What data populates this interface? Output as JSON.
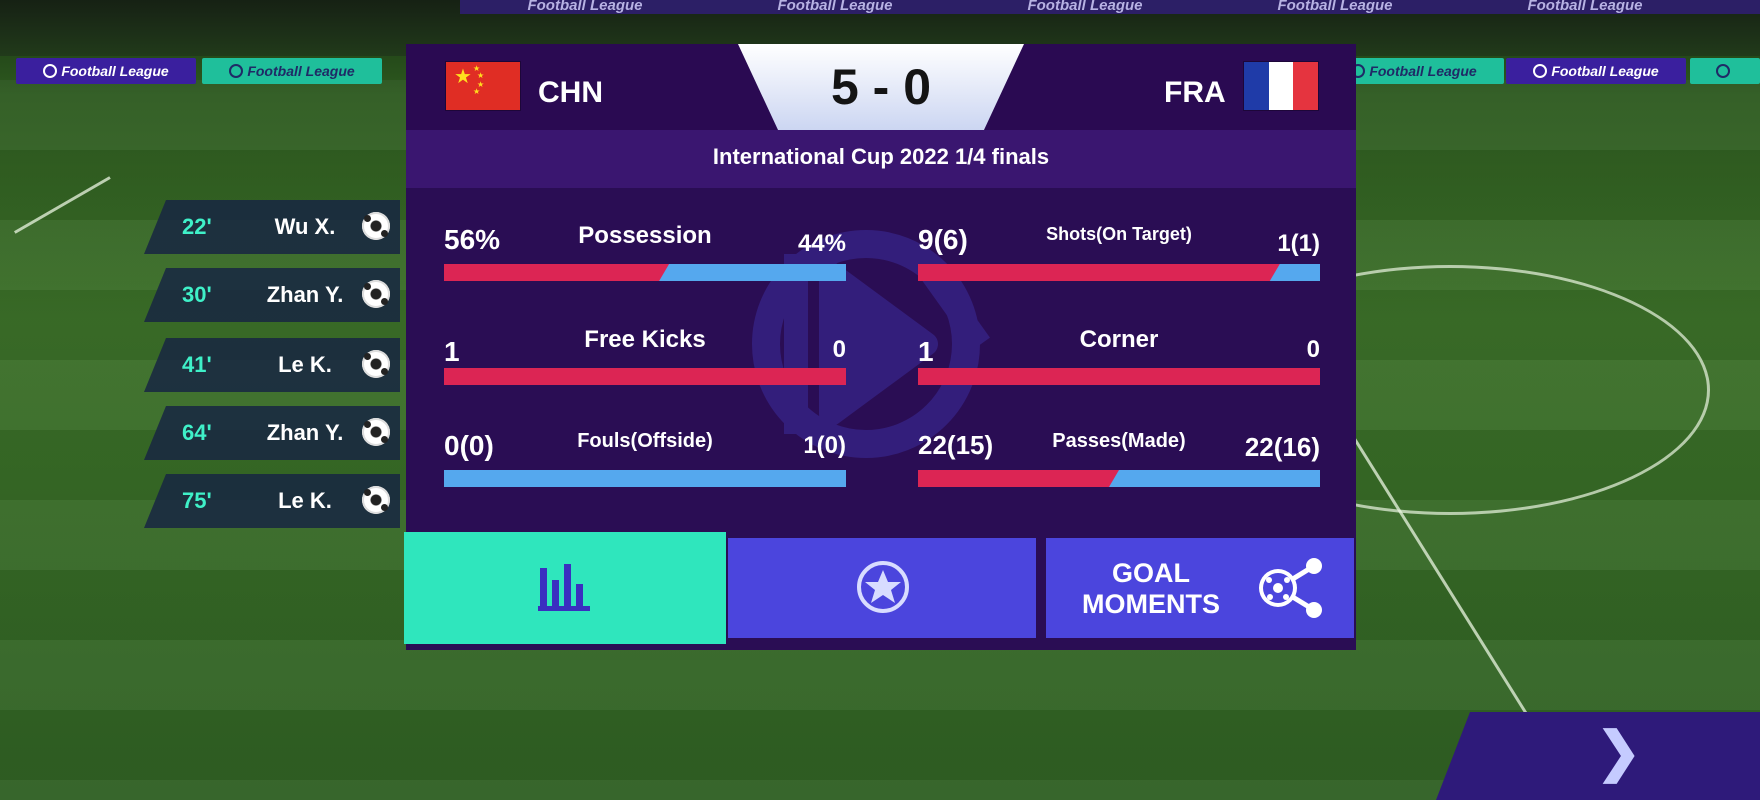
{
  "background": {
    "ad_text": "Football League"
  },
  "goals": [
    {
      "minute": "22'",
      "player": "Wu X."
    },
    {
      "minute": "30'",
      "player": "Zhan Y."
    },
    {
      "minute": "41'",
      "player": "Le K."
    },
    {
      "minute": "64'",
      "player": "Zhan Y."
    },
    {
      "minute": "75'",
      "player": "Le K."
    }
  ],
  "match": {
    "home_team": "CHN",
    "away_team": "FRA",
    "score": "5 - 0",
    "competition": "International Cup 2022 1/4 finals"
  },
  "stats": {
    "possession": {
      "label": "Possession",
      "home": "56%",
      "away": "44%",
      "home_share": 0.56
    },
    "shots": {
      "label": "Shots(On Target)",
      "home": "9(6)",
      "away": "1(1)",
      "home_share": 0.9
    },
    "free_kicks": {
      "label": "Free Kicks",
      "home": "1",
      "away": "0",
      "home_share": 1.0
    },
    "corner": {
      "label": "Corner",
      "home": "1",
      "away": "0",
      "home_share": 1.0
    },
    "fouls": {
      "label": "Fouls(Offside)",
      "home": "0(0)",
      "away": "1(0)",
      "home_share": 0.0
    },
    "passes": {
      "label": "Passes(Made)",
      "home": "22(15)",
      "away": "22(16)",
      "home_share": 0.5
    }
  },
  "tabs": {
    "stats_icon": "bar-chart-icon",
    "rating_icon": "star-circle-icon",
    "goal_moments_label_line1": "GOAL",
    "goal_moments_label_line2": "MOMENTS",
    "goal_moments_icon": "soccer-share-icon",
    "active": "stats"
  },
  "navigation": {
    "next_glyph": "❯"
  },
  "colors": {
    "panel": "#2a0d54",
    "home_bar": "#dc2554",
    "away_bar": "#55a8ee",
    "active_tab": "#2fe6bd",
    "tab": "#4b45dd",
    "minute_text": "#3ff0c8"
  }
}
